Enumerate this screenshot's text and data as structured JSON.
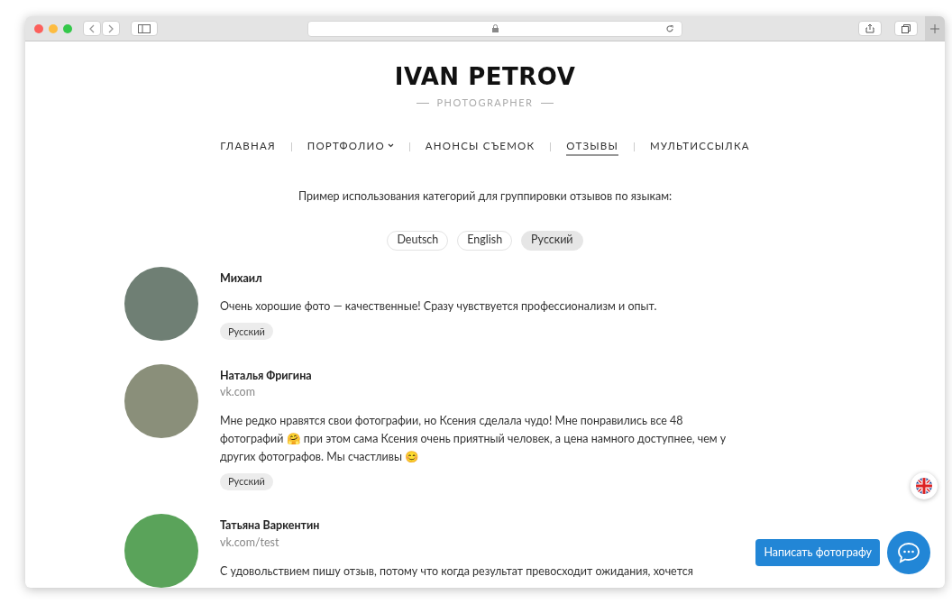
{
  "browser": {
    "address_secure": true
  },
  "site": {
    "title": "IVAN PETROV",
    "subtitle": "PHOTOGRAPHER"
  },
  "nav": [
    {
      "label": "ГЛАВНАЯ",
      "selected": false,
      "dropdown": false
    },
    {
      "label": "ПОРТФОЛИО",
      "selected": false,
      "dropdown": true
    },
    {
      "label": "АНОНСЫ СЪЕМОК",
      "selected": false,
      "dropdown": false
    },
    {
      "label": "ОТЗЫВЫ",
      "selected": true,
      "dropdown": false
    },
    {
      "label": "МУЛЬТИССЫЛКА",
      "selected": false,
      "dropdown": false
    }
  ],
  "intro": "Пример использования категорий для группировки отзывов по языкам:",
  "filters": [
    {
      "label": "Deutsch",
      "selected": false
    },
    {
      "label": "English",
      "selected": false
    },
    {
      "label": "Русский",
      "selected": true
    }
  ],
  "reviews": [
    {
      "name": "Михаил",
      "text": "Очень хорошие фото — качественные! Сразу чувствуется профессионализм и опыт.",
      "tag": "Русский",
      "color": "#6f7f74"
    },
    {
      "name": "Наталья Фригина",
      "source": "vk.com",
      "text": "Мне редко нравятся свои фотографии, но Ксения сделала чудо! Мне понравились все 48 фотографий 🤗 при этом сама Ксения очень приятный человек, а цена намного доступнее, чем у других фотографов. Мы счастливы 😊",
      "tag": "Русский",
      "color": "#8a8f7a"
    },
    {
      "name": "Татьяна Варкентин",
      "source": "vk.com/test",
      "text": "С удовольствием пишу отзыв, потому что когда результат превосходит ожидания, хочется",
      "color": "#5aa35a"
    }
  ],
  "contact_button": "Написать фотографу"
}
